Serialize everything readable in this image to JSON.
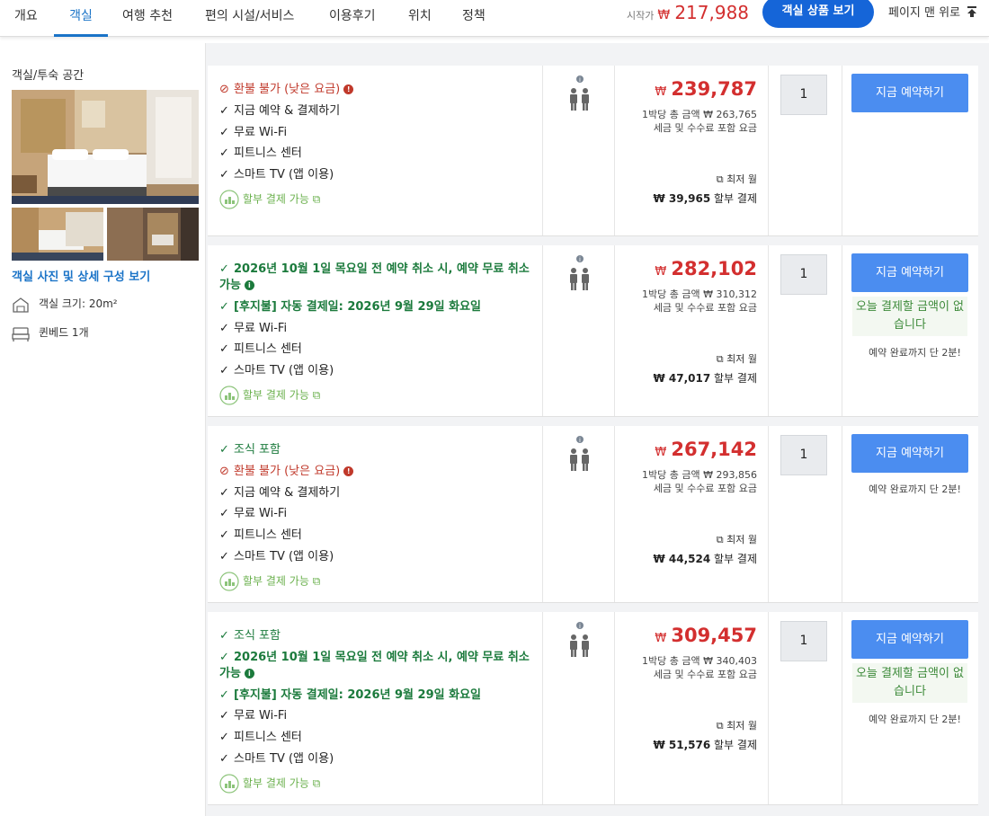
{
  "nav": {
    "tabs": [
      "개요",
      "객실",
      "여행 추천",
      "편의 시설/서비스",
      "이용후기",
      "위치",
      "정책"
    ],
    "start_label": "시작가",
    "start_currency": "₩",
    "start_price": "217,988",
    "cta_label": "객실 상품 보기",
    "top_label": "페이지 맨 위로"
  },
  "sidebar": {
    "title": "객실/투숙 공간",
    "photos_link": "객실 사진 및 상세 구성 보기",
    "size": "객실 크기: 20m²",
    "bed": "퀸베드 1개"
  },
  "rooms": [
    {
      "features": [
        "환불 불가 (낮은 요금)",
        "지금 예약 & 결제하기",
        "무료 Wi-Fi",
        "피트니스 센터",
        "스마트 TV (앱 이용)",
        "할부 결제 가능"
      ],
      "currency": "₩",
      "price": "239,787",
      "per_night": "1박당 총 금액 ₩ 263,765",
      "tax_note": "세금 및 수수료 포함 요금",
      "lowest_label": "최저 월",
      "installment_amount": "₩ 39,965",
      "installment_label": "할부 결제",
      "qty": "1",
      "book_label": "지금 예약하기"
    },
    {
      "features": [
        "2026년 10월 1일 목요일 전 예약 취소 시, 예약 무료 취소 가능",
        "[후지불] 자동 결제일: 2026년 9월 29일 화요일",
        "무료 Wi-Fi",
        "피트니스 센터",
        "스마트 TV (앱 이용)",
        "할부 결제 가능"
      ],
      "currency": "₩",
      "price": "282,102",
      "per_night": "1박당 총 금액 ₩ 310,312",
      "tax_note": "세금 및 수수료 포함 요금",
      "lowest_label": "최저 월",
      "installment_amount": "₩ 47,017",
      "installment_label": "할부 결제",
      "qty": "1",
      "book_label": "지금 예약하기",
      "pay_now": "오늘 결제할 금액이 없습니다",
      "almost": "예약 완료까지 단 2분!"
    },
    {
      "features": [
        "조식 포함",
        "환불 불가 (낮은 요금)",
        "지금 예약 & 결제하기",
        "무료 Wi-Fi",
        "피트니스 센터",
        "스마트 TV (앱 이용)",
        "할부 결제 가능"
      ],
      "currency": "₩",
      "price": "267,142",
      "per_night": "1박당 총 금액 ₩ 293,856",
      "tax_note": "세금 및 수수료 포함 요금",
      "lowest_label": "최저 월",
      "installment_amount": "₩ 44,524",
      "installment_label": "할부 결제",
      "qty": "1",
      "book_label": "지금 예약하기",
      "almost": "예약 완료까지 단 2분!"
    },
    {
      "features": [
        "조식 포함",
        "2026년 10월 1일 목요일 전 예약 취소 시, 예약 무료 취소 가능",
        "[후지불] 자동 결제일: 2026년 9월 29일 화요일",
        "무료 Wi-Fi",
        "피트니스 센터",
        "스마트 TV (앱 이용)",
        "할부 결제 가능"
      ],
      "currency": "₩",
      "price": "309,457",
      "per_night": "1박당 총 금액 ₩ 340,403",
      "tax_note": "세금 및 수수료 포함 요금",
      "lowest_label": "최저 월",
      "installment_amount": "₩ 51,576",
      "installment_label": "할부 결제",
      "qty": "1",
      "book_label": "지금 예약하기",
      "pay_now": "오늘 결제할 금액이 없습니다",
      "almost": "예약 완료까지 단 2분!"
    }
  ],
  "colors": {
    "accent": "#1a73c7",
    "price_red": "#d32f2f",
    "green": "#1b7a3c",
    "book_button": "#4b8df0"
  }
}
